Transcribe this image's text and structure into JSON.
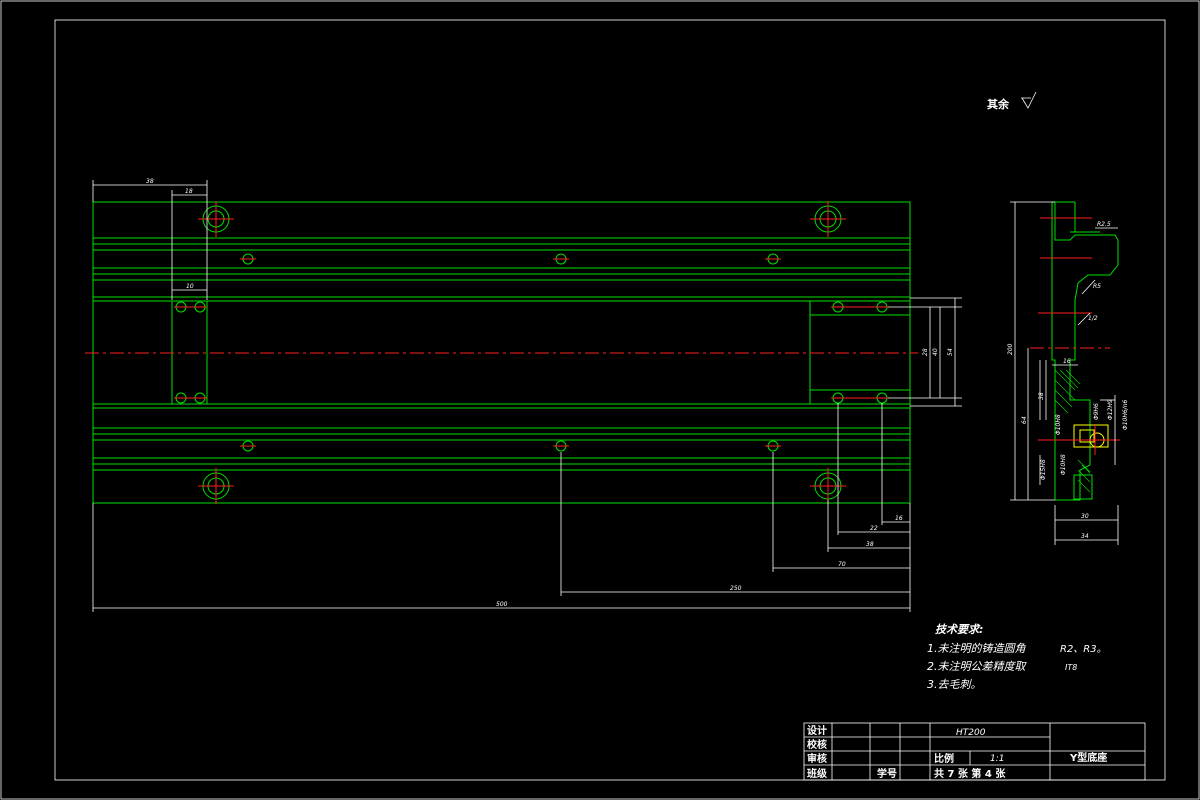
{
  "drawing": {
    "surface_note": "其余",
    "dimensions": {
      "d38": "38",
      "d18": "18",
      "d10": "10",
      "d28": "28",
      "d40": "40",
      "d54": "54",
      "d22": "22",
      "d16": "16",
      "d38b": "38",
      "d70": "70",
      "d250": "250",
      "d500": "500"
    },
    "side_view": {
      "r25": "R2.5",
      "r5": "R5",
      "ra": "1/2",
      "h200": "200",
      "d16": "16",
      "d38": "38",
      "d64": "64",
      "dm1": "Φ10H8",
      "dm2": "Φ15H8",
      "dm3": "Φ10H8",
      "dm4": "Φ9H6",
      "dm5": "Φ12H9",
      "dm6": "Φ10H6/n6",
      "w30": "30",
      "w34": "34"
    },
    "tech_requirements": {
      "title": "技术要求:",
      "line1": "1.未注明的铸造圆角",
      "line1_val": "R2、R3。",
      "line2": "2.未注明公差精度取",
      "line2_val": "IT8",
      "line3": "3.去毛刺。"
    },
    "title_block": {
      "material": "HT200",
      "design": "设计",
      "check": "校核",
      "review": "审核",
      "class": "班级",
      "student_no": "学号",
      "scale_label": "比例",
      "scale": "1:1",
      "part_name": "Y型底座",
      "sheet_info": "共 7  张  第 4  张"
    }
  }
}
